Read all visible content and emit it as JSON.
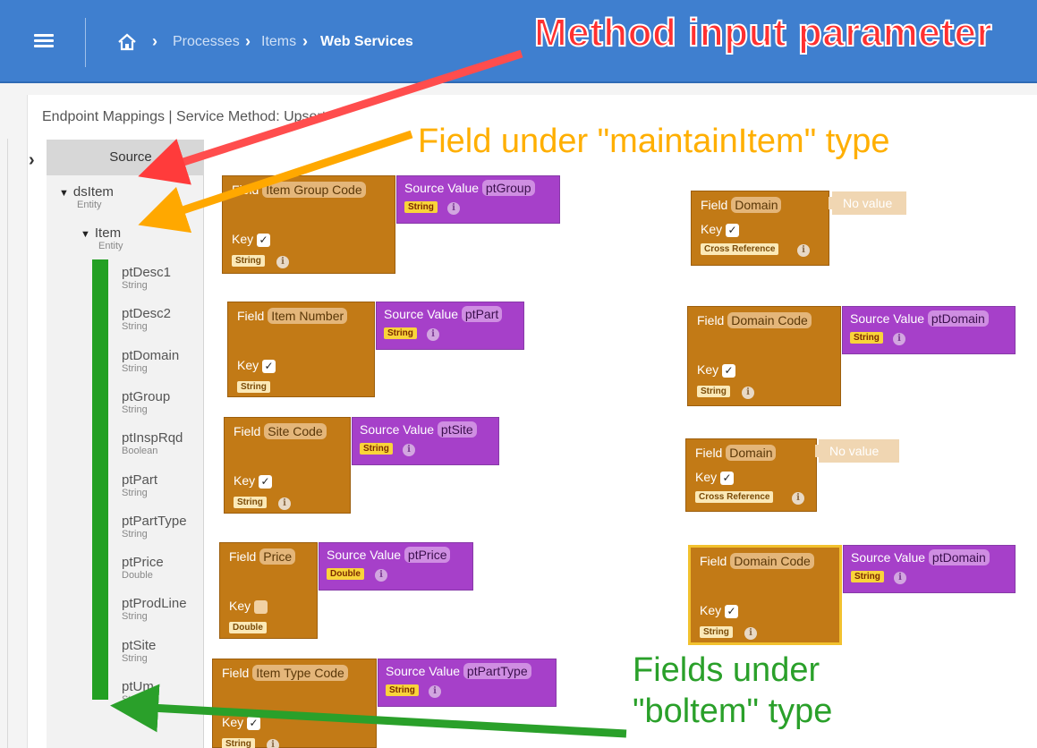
{
  "topbar": {
    "breadcrumb": {
      "home_icon": "home-icon",
      "processes": "Processes",
      "items": "Items",
      "current": "Web Services"
    }
  },
  "panel": {
    "title": "Endpoint Mappings  |  Service Method: Upsert"
  },
  "tree": {
    "header": "Source",
    "root": {
      "name": "dsItem",
      "type": "Entity"
    },
    "child": {
      "name": "Item",
      "type": "Entity"
    },
    "leaves": [
      {
        "name": "ptDesc1",
        "type": "String"
      },
      {
        "name": "ptDesc2",
        "type": "String"
      },
      {
        "name": "ptDomain",
        "type": "String"
      },
      {
        "name": "ptGroup",
        "type": "String"
      },
      {
        "name": "ptInspRqd",
        "type": "Boolean"
      },
      {
        "name": "ptPart",
        "type": "String"
      },
      {
        "name": "ptPartType",
        "type": "String"
      },
      {
        "name": "ptPrice",
        "type": "Double"
      },
      {
        "name": "ptProdLine",
        "type": "String"
      },
      {
        "name": "ptSite",
        "type": "String"
      },
      {
        "name": "ptUm",
        "type": "String"
      }
    ]
  },
  "labels": {
    "field": "Field",
    "key": "Key",
    "source_value": "Source Value",
    "no_value": "No value",
    "check": "✓",
    "info": "i"
  },
  "blocks": [
    {
      "field": "Item Group Code",
      "type": "String",
      "key": true,
      "source": "ptGroup",
      "source_type": "String"
    },
    {
      "field": "Item Number",
      "type": "String",
      "key": true,
      "source": "ptPart",
      "source_type": "String"
    },
    {
      "field": "Site Code",
      "type": "String",
      "key": true,
      "source": "ptSite",
      "source_type": "String"
    },
    {
      "field": "Price",
      "type": "Double",
      "key": false,
      "source": "ptPrice",
      "source_type": "Double"
    },
    {
      "field": "Item Type Code",
      "type": "String",
      "key": true,
      "source": "ptPartType",
      "source_type": "String"
    },
    {
      "field": "Domain",
      "type": "Cross Reference",
      "key": true,
      "source": null
    },
    {
      "field": "Domain Code",
      "type": "String",
      "key": true,
      "source": "ptDomain",
      "source_type": "String"
    },
    {
      "field": "Domain",
      "type": "Cross Reference",
      "key": true,
      "source": null
    },
    {
      "field": "Domain Code",
      "type": "String",
      "key": true,
      "source": "ptDomain",
      "source_type": "String",
      "selected": true
    }
  ],
  "annotations": {
    "method_input": "Method input parameter",
    "maintain_item": "Field under \"maintainItem\" type",
    "bo_item_line1": "Fields under",
    "bo_item_line2": "\"boltem\" type"
  },
  "colors": {
    "topbar": "#3f7fcf",
    "field_block": "#c27a16",
    "source_block": "#a640c9",
    "no_value_block": "#f0d6b2",
    "selection": "#f2c12e",
    "red_annotation": "#ff3030",
    "orange_annotation": "#ffaf00",
    "green_annotation": "#2aa02a"
  }
}
